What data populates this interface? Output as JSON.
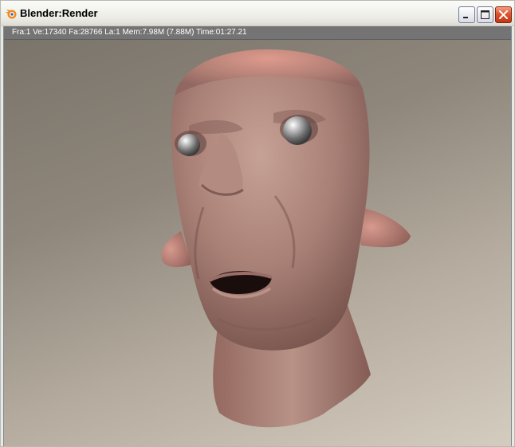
{
  "window": {
    "title": "Blender:Render"
  },
  "status": {
    "text": "Fra:1  Ve:17340 Fa:28766 La:1 Mem:7.98M (7.88M) Time:01:27.21"
  },
  "icons": {
    "app": "blender-logo-icon",
    "minimize": "minimize-icon",
    "maximize": "maximize-icon",
    "close": "close-icon"
  },
  "colors": {
    "status_bar": "#747474",
    "close_button": "#e0532c",
    "skin": "#b48a80"
  }
}
